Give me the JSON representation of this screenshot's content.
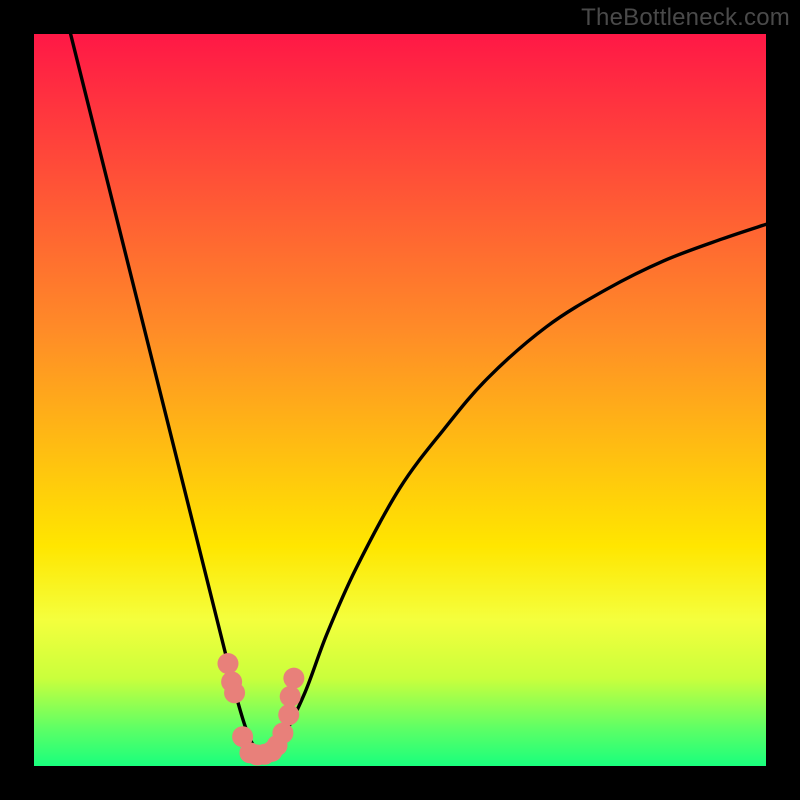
{
  "watermark": "TheBottleneck.com",
  "colors": {
    "frame": "#000000",
    "watermark_text": "#4a4a4a",
    "curve": "#000000",
    "point_fill": "#e8807a",
    "point_stroke": "#e8807a",
    "gradient_top": "#ff1846",
    "gradient_mid1": "#ff7a2a",
    "gradient_mid2": "#ffe600",
    "gradient_band": "#f4ff3d",
    "gradient_green_soft": "#8aff6e",
    "gradient_green_deep": "#19ff7d"
  },
  "chart_data": {
    "type": "line",
    "title": "",
    "xlabel": "",
    "ylabel": "",
    "xlim": [
      0,
      100
    ],
    "ylim": [
      0,
      100
    ],
    "grid": false,
    "legend": false,
    "gradient_stops": [
      {
        "offset": 0.0,
        "color": "#ff1846"
      },
      {
        "offset": 0.4,
        "color": "#ff8a28"
      },
      {
        "offset": 0.7,
        "color": "#ffe600"
      },
      {
        "offset": 0.8,
        "color": "#f4ff3d"
      },
      {
        "offset": 0.88,
        "color": "#caff3c"
      },
      {
        "offset": 0.95,
        "color": "#5cff66"
      },
      {
        "offset": 1.0,
        "color": "#19ff7d"
      }
    ],
    "series": [
      {
        "name": "bottleneck-curve",
        "x": [
          5.0,
          8.0,
          11.0,
          14.0,
          17.0,
          20.0,
          22.0,
          24.0,
          26.0,
          27.5,
          29.0,
          30.5,
          32.0,
          34.0,
          37.0,
          40.0,
          44.0,
          50.0,
          56.0,
          62.0,
          70.0,
          78.0,
          86.0,
          94.0,
          100.0
        ],
        "y": [
          100.0,
          88.0,
          76.0,
          64.0,
          52.0,
          40.0,
          32.0,
          24.0,
          16.0,
          10.0,
          5.0,
          2.0,
          2.0,
          4.0,
          10.0,
          18.0,
          27.0,
          38.0,
          46.0,
          53.0,
          60.0,
          65.0,
          69.0,
          72.0,
          74.0
        ]
      }
    ],
    "points": [
      {
        "x": 26.5,
        "y": 14.0
      },
      {
        "x": 27.0,
        "y": 11.5
      },
      {
        "x": 27.4,
        "y": 10.0
      },
      {
        "x": 28.5,
        "y": 4.0
      },
      {
        "x": 29.5,
        "y": 1.8
      },
      {
        "x": 30.5,
        "y": 1.5
      },
      {
        "x": 31.5,
        "y": 1.6
      },
      {
        "x": 32.5,
        "y": 2.0
      },
      {
        "x": 33.2,
        "y": 2.8
      },
      {
        "x": 34.0,
        "y": 4.5
      },
      {
        "x": 34.8,
        "y": 7.0
      },
      {
        "x": 35.0,
        "y": 9.5
      },
      {
        "x": 35.5,
        "y": 12.0
      }
    ]
  }
}
